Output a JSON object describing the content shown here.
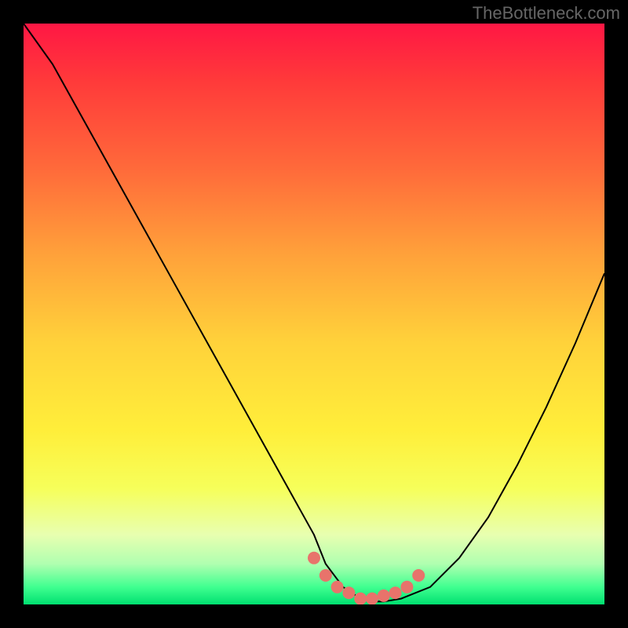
{
  "watermark": "TheBottleneck.com",
  "chart_data": {
    "type": "line",
    "title": "",
    "xlabel": "",
    "ylabel": "",
    "xlim": [
      0,
      100
    ],
    "ylim": [
      0,
      100
    ],
    "series": [
      {
        "name": "bottleneck-curve",
        "x": [
          0,
          5,
          10,
          15,
          20,
          25,
          30,
          35,
          40,
          45,
          50,
          52,
          55,
          58,
          60,
          62,
          65,
          70,
          75,
          80,
          85,
          90,
          95,
          100
        ],
        "y": [
          100,
          93,
          84,
          75,
          66,
          57,
          48,
          39,
          30,
          21,
          12,
          7,
          3,
          1,
          0.5,
          0.5,
          1,
          3,
          8,
          15,
          24,
          34,
          45,
          57
        ]
      }
    ],
    "markers": {
      "name": "highlight-dots",
      "color": "#e8736b",
      "x": [
        50,
        52,
        54,
        56,
        58,
        60,
        62,
        64,
        66,
        68
      ],
      "y": [
        8,
        5,
        3,
        2,
        1,
        1,
        1.5,
        2,
        3,
        5
      ]
    },
    "gradient_stops": [
      {
        "offset": 0.0,
        "color": "#ff1744"
      },
      {
        "offset": 0.1,
        "color": "#ff3a3a"
      },
      {
        "offset": 0.25,
        "color": "#ff6a3a"
      },
      {
        "offset": 0.4,
        "color": "#ffa23a"
      },
      {
        "offset": 0.55,
        "color": "#ffd23a"
      },
      {
        "offset": 0.7,
        "color": "#ffee3a"
      },
      {
        "offset": 0.8,
        "color": "#f6ff5a"
      },
      {
        "offset": 0.88,
        "color": "#e8ffb0"
      },
      {
        "offset": 0.93,
        "color": "#b0ffb0"
      },
      {
        "offset": 0.97,
        "color": "#40ff90"
      },
      {
        "offset": 1.0,
        "color": "#00e070"
      }
    ]
  }
}
